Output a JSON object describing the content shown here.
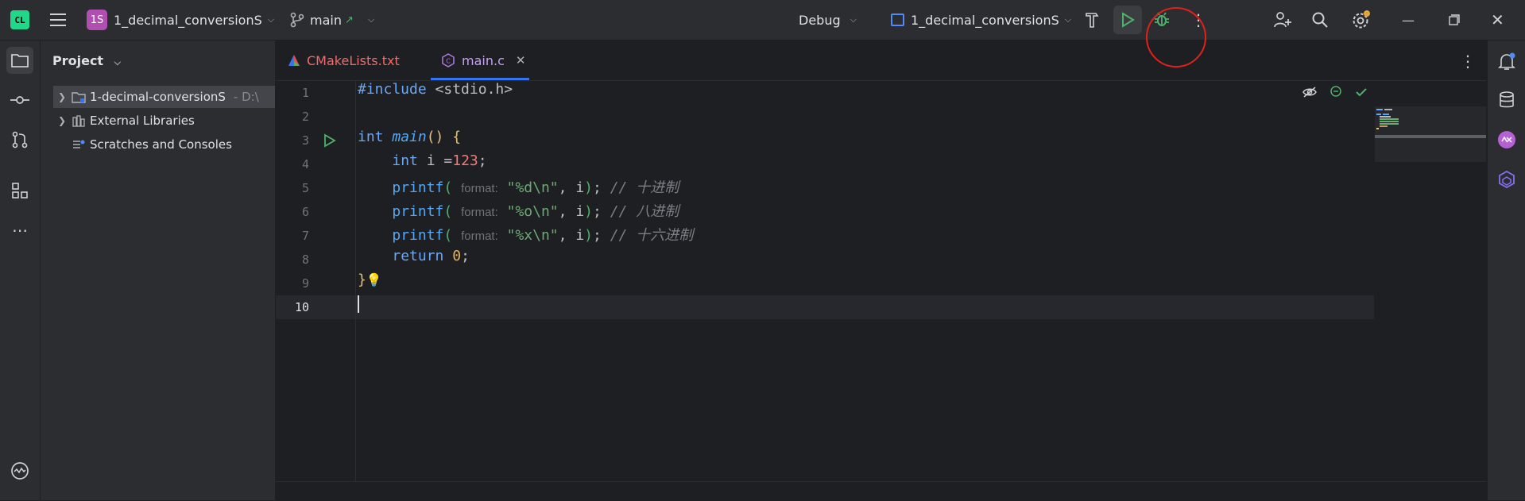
{
  "titlebar": {
    "app_logo_text": "CL",
    "project_badge": "1S",
    "project_name": "1_decimal_conversionS",
    "branch": "main",
    "build_config": "Debug",
    "run_config": "1_decimal_conversionS"
  },
  "project_panel": {
    "title": "Project",
    "tree": [
      {
        "label": "1-decimal-conversionS",
        "path": "- D:\\",
        "expandable": true
      },
      {
        "label": "External Libraries",
        "expandable": true
      },
      {
        "label": "Scratches and Consoles",
        "expandable": false
      }
    ]
  },
  "tabs": [
    {
      "label": "CMakeLists.txt",
      "active": false
    },
    {
      "label": "main.c",
      "active": true
    }
  ],
  "editor": {
    "line_numbers": [
      "1",
      "2",
      "3",
      "4",
      "5",
      "6",
      "7",
      "8",
      "9",
      "10"
    ],
    "current_line": "10",
    "code": {
      "include_kw": "#include",
      "include_file": "<stdio.h>",
      "int_kw": "int",
      "main_fn": "main",
      "paren_open": "()",
      "brace_open": "{",
      "decl_kw": "int",
      "decl_rest": "i =",
      "decl_value": "123",
      "semicolon": ";",
      "printf": "printf",
      "param_hint": "format:",
      "fmt_d": "\"%d\\n\"",
      "fmt_o": "\"%o\\n\"",
      "fmt_x": "\"%x\\n\"",
      "args_tail": ", i",
      "comment_d": "// 十进制",
      "comment_o": "// 八进制",
      "comment_x": "// 十六进制",
      "return_kw": "return",
      "return_value": "0",
      "brace_close": "}"
    }
  },
  "colors": {
    "background": "#1e1f22",
    "panel": "#2b2d30",
    "accent": "#3574f0",
    "run_green": "#4fb16a",
    "annotation_red": "#e0221b"
  }
}
